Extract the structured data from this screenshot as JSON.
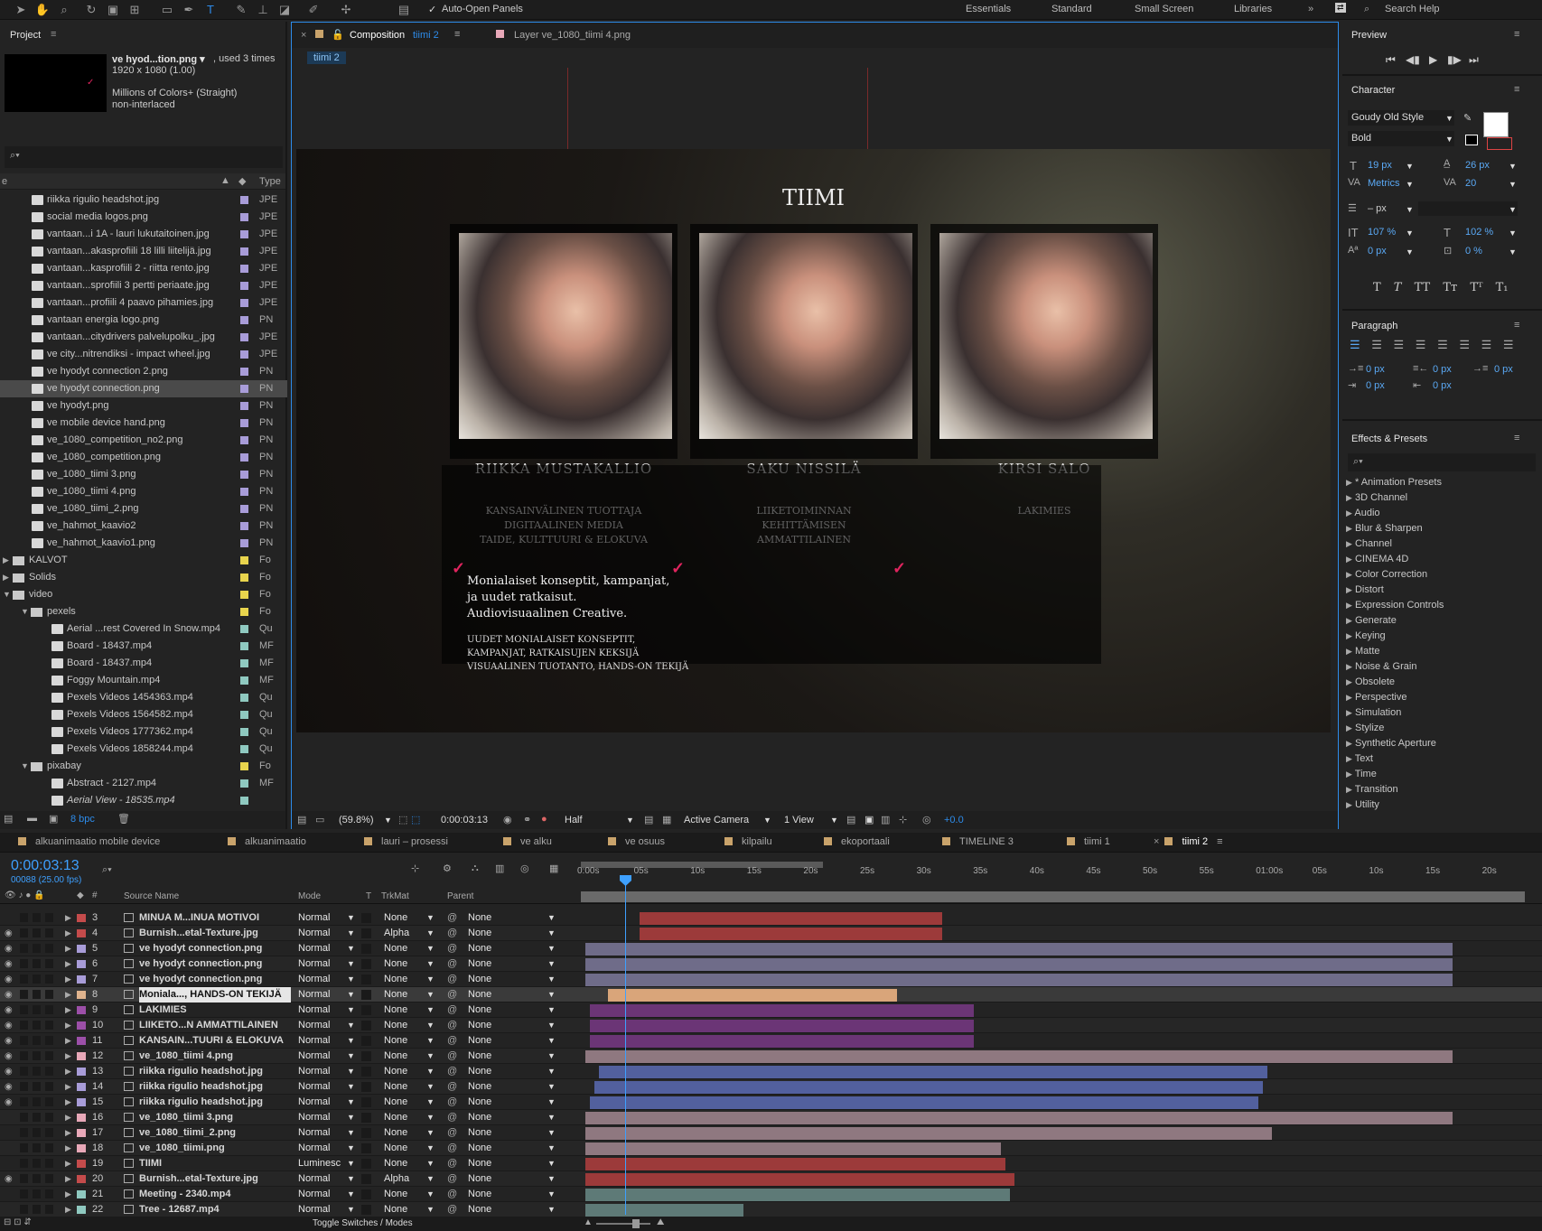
{
  "toolbar": {
    "auto_open": "Auto-Open Panels",
    "workspaces": [
      "Essentials",
      "Standard",
      "Small Screen",
      "Libraries"
    ],
    "search": "Search Help"
  },
  "project": {
    "title": "Project",
    "file_name": "ve hyod...tion.png ▾",
    "used": ", used 3 times",
    "dims": "1920 x 1080 (1.00)",
    "colors": "Millions of Colors+ (Straight)",
    "interlace": "non-interlaced",
    "col_name": "e",
    "col_type": "Type",
    "bpc": "8 bpc",
    "items": [
      {
        "name": "riikka rigulio headshot.jpg",
        "type": "JPE",
        "lbl": "#a89cd8",
        "indent": 48
      },
      {
        "name": "social media logos.png",
        "type": "JPE",
        "lbl": "#a89cd8",
        "indent": 48
      },
      {
        "name": "vantaan...i 1A - lauri lukutaitoinen.jpg",
        "type": "JPE",
        "lbl": "#a89cd8",
        "indent": 48
      },
      {
        "name": "vantaan...akasprofiili 18 lilli liitelijä.jpg",
        "type": "JPE",
        "lbl": "#a89cd8",
        "indent": 48
      },
      {
        "name": "vantaan...kasprofiili 2 - riitta rento.jpg",
        "type": "JPE",
        "lbl": "#a89cd8",
        "indent": 48
      },
      {
        "name": "vantaan...sprofiili 3 pertti periaate.jpg",
        "type": "JPE",
        "lbl": "#a89cd8",
        "indent": 48
      },
      {
        "name": "vantaan...profiili 4 paavo pihamies.jpg",
        "type": "JPE",
        "lbl": "#a89cd8",
        "indent": 48
      },
      {
        "name": "vantaan energia logo.png",
        "type": "PN",
        "lbl": "#a89cd8",
        "indent": 48
      },
      {
        "name": "vantaan...citydrivers palvelupolku_.jpg",
        "type": "JPE",
        "lbl": "#a89cd8",
        "indent": 48
      },
      {
        "name": "ve city...nitrendiksi - impact wheel.jpg",
        "type": "JPE",
        "lbl": "#a89cd8",
        "indent": 48
      },
      {
        "name": "ve hyodyt connection 2.png",
        "type": "PN",
        "lbl": "#a89cd8",
        "indent": 48
      },
      {
        "name": "ve hyodyt connection.png",
        "type": "PN",
        "lbl": "#a89cd8",
        "indent": 48,
        "selected": true
      },
      {
        "name": "ve hyodyt.png",
        "type": "PN",
        "lbl": "#a89cd8",
        "indent": 48
      },
      {
        "name": "ve mobile device hand.png",
        "type": "PN",
        "lbl": "#a89cd8",
        "indent": 48
      },
      {
        "name": "ve_1080_competition_no2.png",
        "type": "PN",
        "lbl": "#a89cd8",
        "indent": 48
      },
      {
        "name": "ve_1080_competition.png",
        "type": "PN",
        "lbl": "#a89cd8",
        "indent": 48
      },
      {
        "name": "ve_1080_tiimi 3.png",
        "type": "PN",
        "lbl": "#a89cd8",
        "indent": 48
      },
      {
        "name": "ve_1080_tiimi 4.png",
        "type": "PN",
        "lbl": "#a89cd8",
        "indent": 48
      },
      {
        "name": "ve_1080_tiimi_2.png",
        "type": "PN",
        "lbl": "#a89cd8",
        "indent": 48
      },
      {
        "name": "ve_hahmot_kaavio2",
        "type": "PN",
        "lbl": "#a89cd8",
        "indent": 48
      },
      {
        "name": "ve_hahmot_kaavio1.png",
        "type": "PN",
        "lbl": "#a89cd8",
        "indent": 48
      },
      {
        "name": "KALVOT",
        "type": "Fo",
        "lbl": "#e8d44d",
        "indent": 14,
        "folder": true
      },
      {
        "name": "Solids",
        "type": "Fo",
        "lbl": "#e8d44d",
        "indent": 14,
        "folder": true
      },
      {
        "name": "video",
        "type": "Fo",
        "lbl": "#e8d44d",
        "indent": 14,
        "folder": true,
        "open": true
      },
      {
        "name": "pexels",
        "type": "Fo",
        "lbl": "#e8d44d",
        "indent": 34,
        "folder": true,
        "open": true
      },
      {
        "name": "Aerial ...rest Covered In Snow.mp4",
        "type": "Qu",
        "lbl": "#8fc9c0",
        "indent": 70
      },
      {
        "name": "Board - 18437.mp4",
        "type": "MF",
        "lbl": "#8fc9c0",
        "indent": 70
      },
      {
        "name": "Board - 18437.mp4",
        "type": "MF",
        "lbl": "#8fc9c0",
        "indent": 70
      },
      {
        "name": "Foggy Mountain.mp4",
        "type": "MF",
        "lbl": "#8fc9c0",
        "indent": 70
      },
      {
        "name": "Pexels Videos 1454363.mp4",
        "type": "Qu",
        "lbl": "#8fc9c0",
        "indent": 70
      },
      {
        "name": "Pexels Videos 1564582.mp4",
        "type": "Qu",
        "lbl": "#8fc9c0",
        "indent": 70
      },
      {
        "name": "Pexels Videos 1777362.mp4",
        "type": "Qu",
        "lbl": "#8fc9c0",
        "indent": 70
      },
      {
        "name": "Pexels Videos 1858244.mp4",
        "type": "Qu",
        "lbl": "#8fc9c0",
        "indent": 70
      },
      {
        "name": "pixabay",
        "type": "Fo",
        "lbl": "#e8d44d",
        "indent": 34,
        "folder": true,
        "open": true
      },
      {
        "name": "Abstract - 2127.mp4",
        "type": "MF",
        "lbl": "#8fc9c0",
        "indent": 70
      },
      {
        "name": "Aerial View - 18535.mp4",
        "type": "",
        "lbl": "#8fc9c0",
        "indent": 70,
        "italic": true
      }
    ]
  },
  "comp": {
    "tab1": "Composition",
    "tab1_name": "tiimi 2",
    "tab2": "Layer ve_1080_tiimi 4.png",
    "crumb": "tiimi 2",
    "zoom": "(59.8%)",
    "time": "0:00:03:13",
    "res": "Half",
    "camera": "Active Camera",
    "views": "1 View",
    "exposure": "+0.0",
    "scene": {
      "title": "TIIMI",
      "people": [
        {
          "name": "RIIKKA MUSTAKALLIO",
          "role": [
            "KANSAINVÄLINEN TUOTTAJA",
            "DIGITAALINEN MEDIA",
            "TAIDE, KULTTUURI & ELOKUVA"
          ]
        },
        {
          "name": "SAKU NISSILÄ",
          "role": [
            "LIIKETOIMINNAN",
            "KEHITTÄMISEN",
            "AMMATTILAINEN"
          ]
        },
        {
          "name": "KIRSI SALO",
          "role": [
            "LAKIMIES"
          ]
        }
      ],
      "tagline": [
        "Monialaiset konseptit, kampanjat,",
        "ja uudet ratkaisut.",
        "Audiovisuaalinen Creative."
      ],
      "caps": [
        "UUDET MONIALAISET KONSEPTIT,",
        "KAMPANJAT, RATKAISUJEN KEKSIJÄ",
        "VISUAALINEN TUOTANTO, HANDS-ON TEKIJÄ"
      ]
    }
  },
  "preview": {
    "title": "Preview"
  },
  "character": {
    "title": "Character",
    "font": "Goudy Old Style",
    "style": "Bold",
    "size": "19 px",
    "leading": "26 px",
    "kerning": "Metrics",
    "tracking": "20",
    "stroke": "– px",
    "vscale": "107 %",
    "hscale": "102 %",
    "baseline": "0 px",
    "tsume": "0 %"
  },
  "paragraph": {
    "title": "Paragraph",
    "v": [
      "0 px",
      "0 px",
      "0 px",
      "0 px",
      "0 px"
    ]
  },
  "effects": {
    "title": "Effects & Presets",
    "items": [
      "* Animation Presets",
      "3D Channel",
      "Audio",
      "Blur & Sharpen",
      "Channel",
      "CINEMA 4D",
      "Color Correction",
      "Distort",
      "Expression Controls",
      "Generate",
      "Keying",
      "Matte",
      "Noise & Grain",
      "Obsolete",
      "Perspective",
      "Simulation",
      "Stylize",
      "Synthetic Aperture",
      "Text",
      "Time",
      "Transition",
      "Utility"
    ]
  },
  "timeline": {
    "tabs": [
      {
        "name": "alkuanimaatio mobile device",
        "c": "#c9a36b"
      },
      {
        "name": "alkuanimaatio",
        "c": "#c9a36b"
      },
      {
        "name": "lauri – prosessi",
        "c": "#c9a36b"
      },
      {
        "name": "ve alku",
        "c": "#c9a36b"
      },
      {
        "name": "ve osuus",
        "c": "#c9a36b"
      },
      {
        "name": "kilpailu",
        "c": "#c9a36b"
      },
      {
        "name": "ekoportaali",
        "c": "#c9a36b"
      },
      {
        "name": "TIMELINE 3",
        "c": "#c9a36b"
      },
      {
        "name": "tiimi 1",
        "c": "#c9a36b"
      },
      {
        "name": "tiimi 2",
        "c": "#c9a36b"
      }
    ],
    "timecode": "0:00:03:13",
    "frames": "00088 (25.00 fps)",
    "cols": {
      "source": "Source Name",
      "mode": "Mode",
      "t": "T",
      "trk": "TrkMat",
      "parent": "Parent"
    },
    "ruler": [
      "0:00s",
      "05s",
      "10s",
      "15s",
      "20s",
      "25s",
      "30s",
      "35s",
      "40s",
      "45s",
      "50s",
      "55s",
      "01:00s",
      "05s",
      "10s",
      "15s",
      "20s"
    ],
    "toggle": "Toggle Switches / Modes",
    "layers": [
      {
        "n": "3",
        "name": "MINUA M...INUA MOTIVOI",
        "mode": "Normal",
        "trk": "None",
        "parent": "None",
        "c": "#c44b4b",
        "b0": 60,
        "b1": 395,
        "bc": "#9c3a3a",
        "eye": false
      },
      {
        "n": "4",
        "name": "Burnish...etal-Texture.jpg",
        "mode": "Normal",
        "trk": "Alpha",
        "parent": "None",
        "c": "#c44b4b",
        "b0": 60,
        "b1": 395,
        "bc": "#9c3a3a",
        "eye": true
      },
      {
        "n": "5",
        "name": "ve hyodyt connection.png",
        "mode": "Normal",
        "trk": "None",
        "parent": "None",
        "c": "#a89cd8",
        "b0": 0,
        "b1": 960,
        "bc": "#6f6c89",
        "eye": true
      },
      {
        "n": "6",
        "name": "ve hyodyt connection.png",
        "mode": "Normal",
        "trk": "None",
        "parent": "None",
        "c": "#a89cd8",
        "b0": 0,
        "b1": 960,
        "bc": "#6f6c89",
        "eye": true
      },
      {
        "n": "7",
        "name": "ve hyodyt connection.png",
        "mode": "Normal",
        "trk": "None",
        "parent": "None",
        "c": "#a89cd8",
        "b0": 0,
        "b1": 960,
        "bc": "#6f6c89",
        "eye": true
      },
      {
        "n": "8",
        "name": "Moniala..., HANDS-ON TEKIJÄ",
        "mode": "Normal",
        "trk": "None",
        "parent": "None",
        "c": "#e0b48e",
        "b0": 25,
        "b1": 345,
        "bc": "#d9a57a",
        "eye": true,
        "sel": true
      },
      {
        "n": "9",
        "name": "LAKIMIES",
        "mode": "Normal",
        "trk": "None",
        "parent": "None",
        "c": "#9c4fa8",
        "b0": 5,
        "b1": 430,
        "bc": "#6b3576",
        "eye": true
      },
      {
        "n": "10",
        "name": "LIIKETO...N AMMATTILAINEN",
        "mode": "Normal",
        "trk": "None",
        "parent": "None",
        "c": "#9c4fa8",
        "b0": 5,
        "b1": 430,
        "bc": "#6b3576",
        "eye": true
      },
      {
        "n": "11",
        "name": "KANSAIN...TUURI & ELOKUVA",
        "mode": "Normal",
        "trk": "None",
        "parent": "None",
        "c": "#9c4fa8",
        "b0": 5,
        "b1": 430,
        "bc": "#6b3576",
        "eye": true
      },
      {
        "n": "12",
        "name": "ve_1080_tiimi 4.png",
        "mode": "Normal",
        "trk": "None",
        "parent": "None",
        "c": "#e8a8b8",
        "b0": 0,
        "b1": 960,
        "bc": "#8f7880",
        "eye": true
      },
      {
        "n": "13",
        "name": "riikka rigulio headshot.jpg",
        "mode": "Normal",
        "trk": "None",
        "parent": "None",
        "c": "#a89cd8",
        "b0": 15,
        "b1": 755,
        "bc": "#52609e",
        "eye": true
      },
      {
        "n": "14",
        "name": "riikka rigulio headshot.jpg",
        "mode": "Normal",
        "trk": "None",
        "parent": "None",
        "c": "#a89cd8",
        "b0": 10,
        "b1": 750,
        "bc": "#52609e",
        "eye": true
      },
      {
        "n": "15",
        "name": "riikka rigulio headshot.jpg",
        "mode": "Normal",
        "trk": "None",
        "parent": "None",
        "c": "#a89cd8",
        "b0": 5,
        "b1": 745,
        "bc": "#52609e",
        "eye": true
      },
      {
        "n": "16",
        "name": "ve_1080_tiimi 3.png",
        "mode": "Normal",
        "trk": "None",
        "parent": "None",
        "c": "#e8a8b8",
        "b0": 0,
        "b1": 960,
        "bc": "#8f7880",
        "eye": false
      },
      {
        "n": "17",
        "name": "ve_1080_tiimi_2.png",
        "mode": "Normal",
        "trk": "None",
        "parent": "None",
        "c": "#e8a8b8",
        "b0": 0,
        "b1": 760,
        "bc": "#8f7880",
        "eye": false
      },
      {
        "n": "18",
        "name": "ve_1080_tiimi.png",
        "mode": "Normal",
        "trk": "None",
        "parent": "None",
        "c": "#e8a8b8",
        "b0": 0,
        "b1": 460,
        "bc": "#8f7880",
        "eye": false
      },
      {
        "n": "19",
        "name": "TIIMI",
        "mode": "Luminesc",
        "trk": "None",
        "parent": "None",
        "c": "#c44b4b",
        "b0": 0,
        "b1": 465,
        "bc": "#9c3a3a",
        "eye": false
      },
      {
        "n": "20",
        "name": "Burnish...etal-Texture.jpg",
        "mode": "Normal",
        "trk": "Alpha",
        "parent": "None",
        "c": "#c44b4b",
        "b0": 0,
        "b1": 475,
        "bc": "#9c3a3a",
        "eye": true
      },
      {
        "n": "21",
        "name": "Meeting - 2340.mp4",
        "mode": "Normal",
        "trk": "None",
        "parent": "None",
        "c": "#8fc9c0",
        "b0": 0,
        "b1": 470,
        "bc": "#5e7a77",
        "eye": false
      },
      {
        "n": "22",
        "name": "Tree - 12687.mp4",
        "mode": "Normal",
        "trk": "None",
        "parent": "None",
        "c": "#8fc9c0",
        "b0": 0,
        "b1": 175,
        "bc": "#5e7a77",
        "eye": false
      }
    ]
  }
}
